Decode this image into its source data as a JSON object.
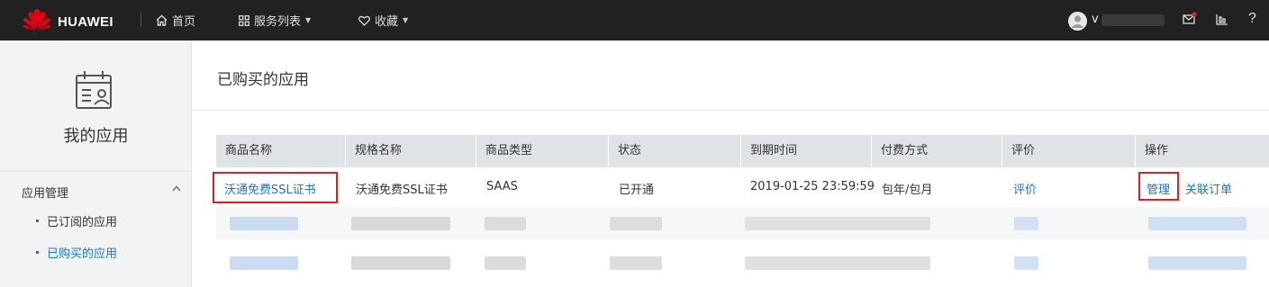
{
  "brand": {
    "name": "HUAWEI",
    "colors": {
      "topbar": "#212121",
      "logo_red": "#e60012"
    }
  },
  "nav": {
    "home": {
      "icon": "home-icon",
      "label": "首页"
    },
    "services": {
      "icon": "grid-icon",
      "label": "服务列表"
    },
    "favorites": {
      "icon": "heart-icon",
      "label": "收藏"
    }
  },
  "user": {
    "name_prefix": "v"
  },
  "topbar_icons": [
    "mail-icon",
    "bar-chart-icon",
    "help-icon"
  ],
  "sidebar": {
    "title": "我的应用",
    "group": {
      "label": "应用管理",
      "expanded": true
    },
    "items": [
      {
        "label": "已订阅的应用",
        "active": false
      },
      {
        "label": "已购买的应用",
        "active": true
      }
    ]
  },
  "main": {
    "title": "已购买的应用",
    "table": {
      "columns": [
        "商品名称",
        "规格名称",
        "商品类型",
        "状态",
        "到期时间",
        "付费方式",
        "评价",
        "操作"
      ],
      "rows": [
        {
          "product_name": "沃通免费SSL证书",
          "spec_name": "沃通免费SSL证书",
          "product_type": "SAAS",
          "status": "已开通",
          "expiry": "2019-01-25 23:59:59",
          "payment": "包年/包月",
          "review": "评价",
          "actions": [
            "管理",
            "关联订单"
          ]
        }
      ]
    }
  },
  "accent": "#1a75ce",
  "highlight": "#e02020"
}
